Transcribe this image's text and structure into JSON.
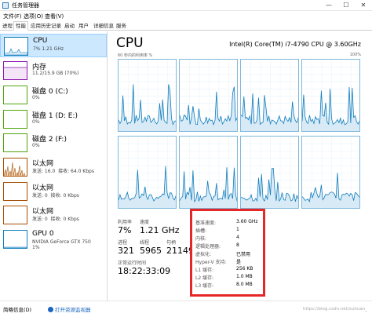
{
  "window": {
    "title": "任务管理器",
    "minimize": "—",
    "maximize": "☐",
    "close": "✕"
  },
  "menu": [
    "文件(F)",
    "选项(O)",
    "查看(V)"
  ],
  "tabs": [
    "进程",
    "性能",
    "应用历史记录",
    "启动",
    "用户",
    "详细信息",
    "服务"
  ],
  "active_tab": "性能",
  "sidebar": {
    "items": [
      {
        "name": "CPU",
        "sub": "7% 1.21 GHz",
        "sub2": "",
        "color": "#117dbb",
        "selected": true
      },
      {
        "name": "内存",
        "sub": "11.2/15.9 GB (70%)",
        "sub2": "",
        "color": "#8b12ae",
        "selected": false
      },
      {
        "name": "磁盘 0 (C:)",
        "sub": "0%",
        "sub2": "",
        "color": "#4da60c",
        "selected": false
      },
      {
        "name": "磁盘 1 (D: E:)",
        "sub": "0%",
        "sub2": "",
        "color": "#4da60c",
        "selected": false
      },
      {
        "name": "磁盘 2 (F:)",
        "sub": "0%",
        "sub2": "",
        "color": "#4da60c",
        "selected": false
      },
      {
        "name": "以太网",
        "sub": "发送: 16.0  接收: 64.0 Kbps",
        "sub2": "",
        "color": "#a74f01",
        "selected": false
      },
      {
        "name": "以太网",
        "sub": "发送: 0  接收: 0 Kbps",
        "sub2": "",
        "color": "#a74f01",
        "selected": false
      },
      {
        "name": "以太网",
        "sub": "发送: 0  接收: 0 Kbps",
        "sub2": "",
        "color": "#a74f01",
        "selected": false
      },
      {
        "name": "GPU 0",
        "sub": "NVIDIA GeForce GTX 750",
        "sub2": "1%",
        "color": "#117dbb",
        "selected": false
      }
    ]
  },
  "main": {
    "title": "CPU",
    "model": "Intel(R) Core(TM) i7-4790 CPU @ 3.60GHz",
    "util_label": "60 秒内的利用率 %",
    "util_max": "100%",
    "stats": {
      "utilization_label": "利用率",
      "utilization": "7%",
      "speed_label": "速度",
      "speed": "1.21 GHz",
      "processes_label": "进程",
      "processes": "321",
      "threads_label": "线程",
      "threads": "5965",
      "handles_label": "句柄",
      "handles": "21149",
      "uptime_label": "正常运行时间",
      "uptime": "18:22:33:09"
    },
    "details": [
      {
        "k": "基准速度:",
        "v": "3.60 GHz"
      },
      {
        "k": "插槽:",
        "v": "1"
      },
      {
        "k": "内核:",
        "v": "4"
      },
      {
        "k": "逻辑处理器:",
        "v": "8"
      },
      {
        "k": "虚拟化:",
        "v": "已禁用"
      },
      {
        "k": "Hyper-V 支持:",
        "v": "是"
      },
      {
        "k": "L1 缓存:",
        "v": "256 KB"
      },
      {
        "k": "L2 缓存:",
        "v": "1.0 MB"
      },
      {
        "k": "L3 缓存:",
        "v": "8.0 MB"
      }
    ]
  },
  "footer": {
    "fewer_details": "简略信息(D)",
    "open_monitor": "打开资源监视器",
    "watermark": "https://blog.csdn.net/xuhuan_"
  }
}
